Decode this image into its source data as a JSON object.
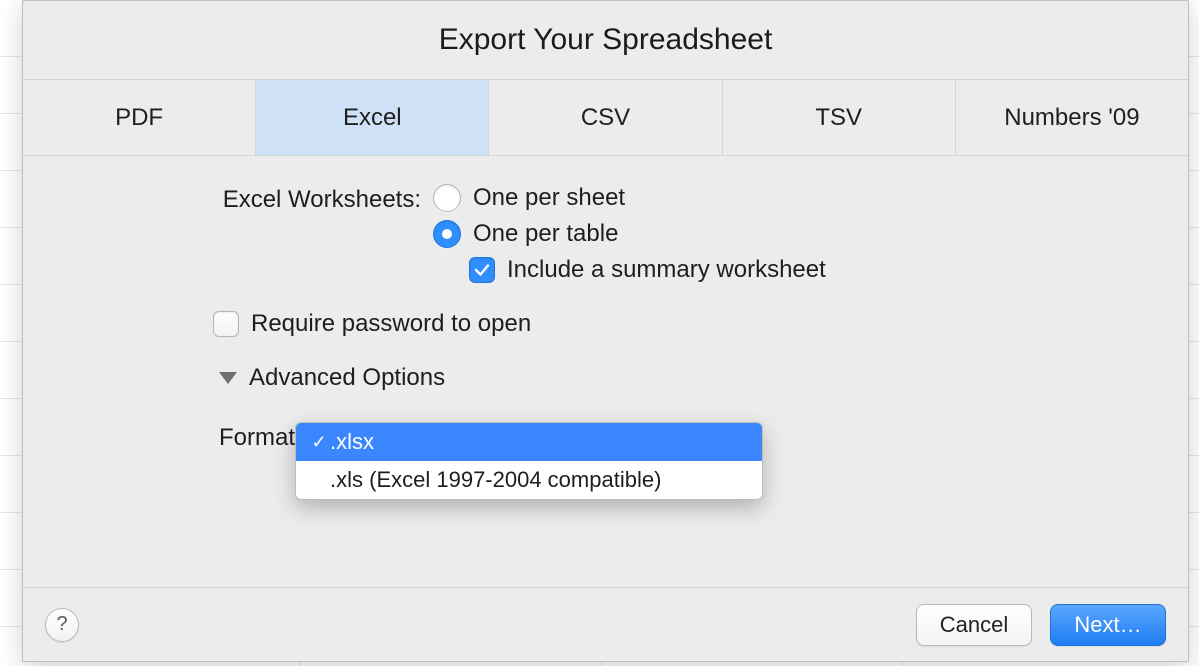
{
  "dialog": {
    "title": "Export Your Spreadsheet"
  },
  "tabs": {
    "pdf": "PDF",
    "excel": "Excel",
    "csv": "CSV",
    "tsv": "TSV",
    "numbers09": "Numbers '09",
    "selected": "excel"
  },
  "worksheets": {
    "label": "Excel Worksheets:",
    "option_per_sheet": "One per sheet",
    "option_per_table": "One per table",
    "include_summary": "Include a summary worksheet"
  },
  "require_password": "Require password to open",
  "advanced": {
    "label": "Advanced Options"
  },
  "format": {
    "label": "Format",
    "option_xlsx": ".xlsx",
    "option_xls": ".xls (Excel 1997-2004 compatible)"
  },
  "footer": {
    "help": "?",
    "cancel": "Cancel",
    "next": "Next…"
  }
}
